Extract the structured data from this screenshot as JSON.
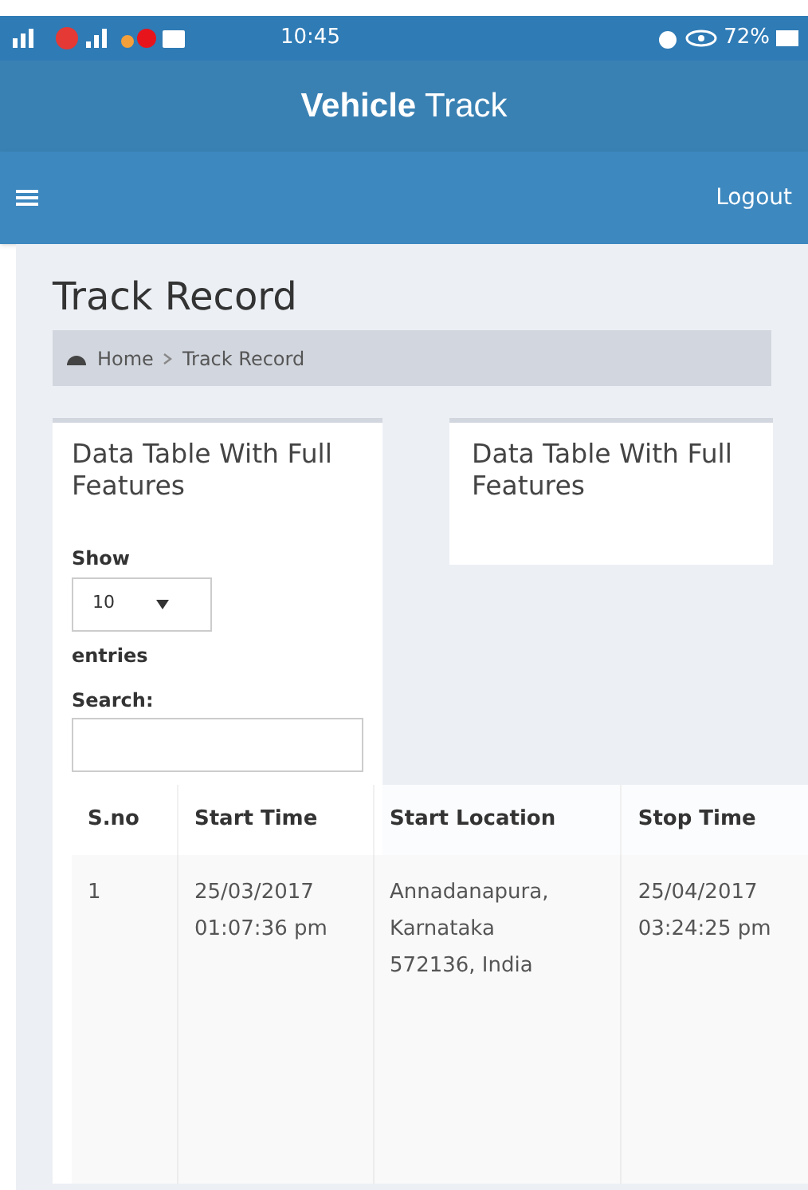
{
  "status_bar": {
    "time": "10:45",
    "battery": "72%"
  },
  "app_title": "**Vehicle** Track",
  "nav": {
    "logout": "Logout"
  },
  "page_title": "Track Record",
  "breadcrumb": [
    "Home",
    "Track Record"
  ],
  "cards": [
    {
      "title": "Data Table With Full Features"
    },
    {
      "title": "Data Table With Full Features"
    }
  ],
  "length_control": {
    "label_before": "Show",
    "value": "10",
    "label_after": "entries"
  },
  "search": {
    "label": "Search:"
  },
  "table": {
    "columns": [
      "S.no",
      "Start Time",
      "Start Location",
      "Stop Time"
    ],
    "rows": [
      [
        "1",
        "25/03/2017 01:07:36 pm",
        "Annadanapura, Karnataka 572136, India",
        "25/04/2017 03:24:25 pm"
      ]
    ]
  }
}
